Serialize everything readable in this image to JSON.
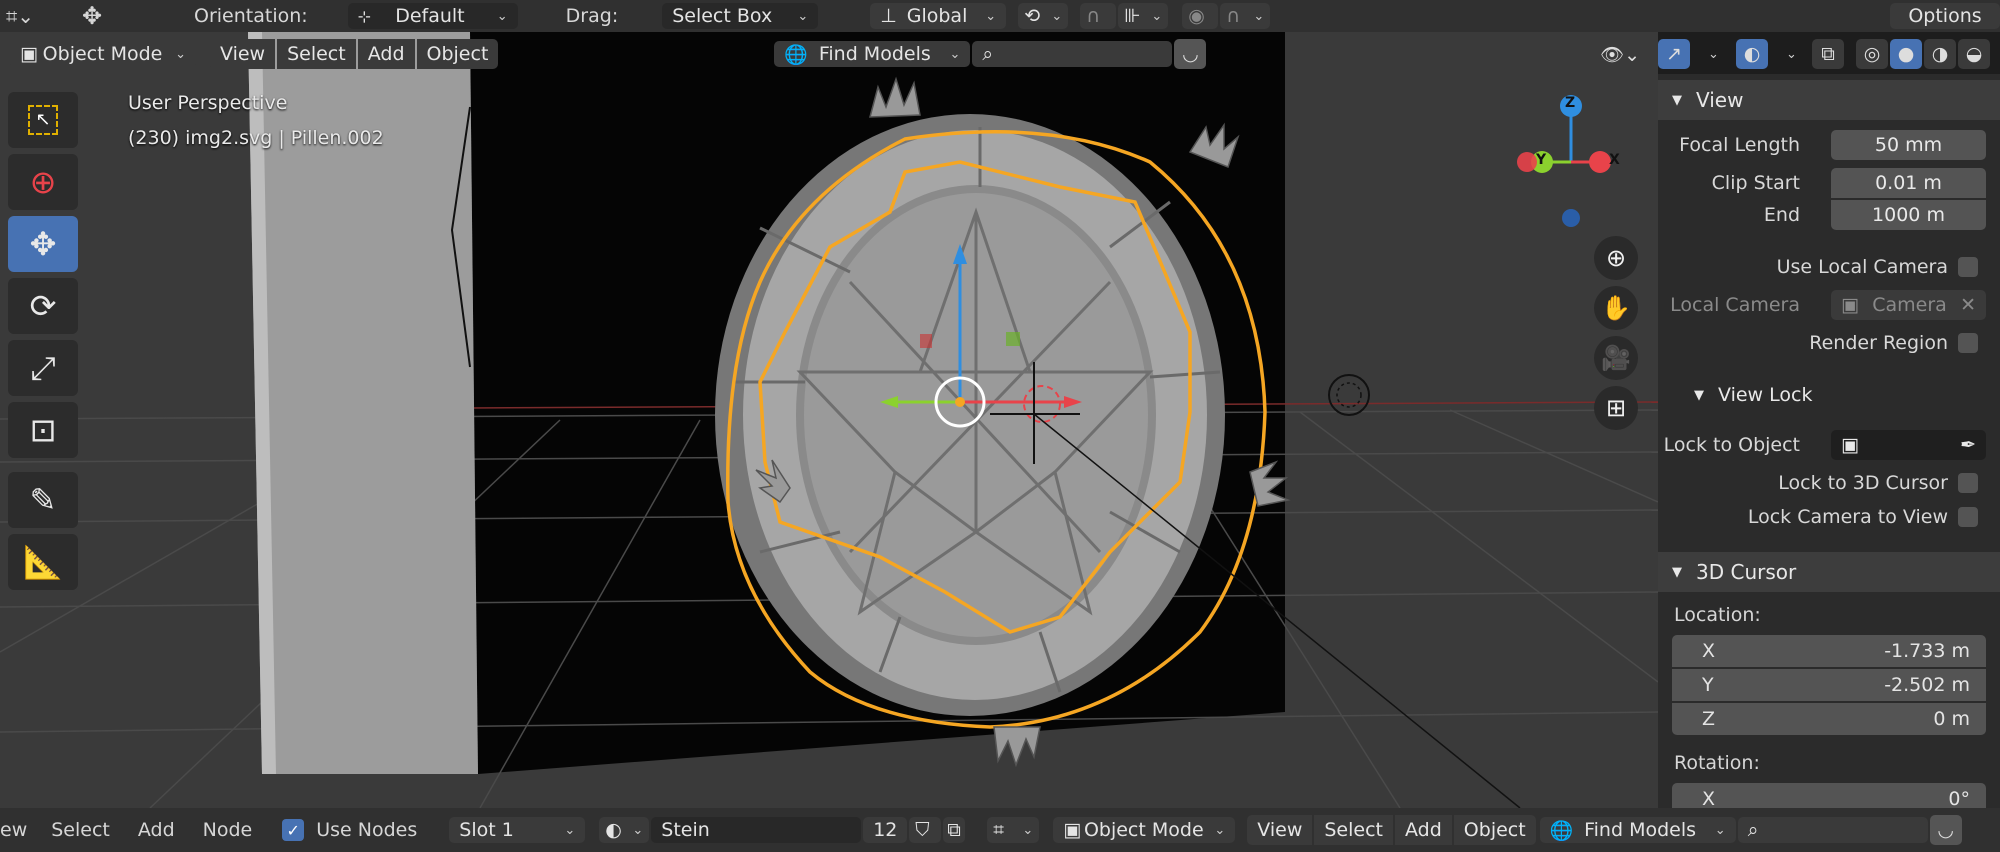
{
  "topbar": {
    "orientation_label": "Orientation:",
    "orientation_value": "Default",
    "drag_label": "Drag:",
    "drag_value": "Select Box",
    "transform_orientation": "Global",
    "options_label": "Options"
  },
  "header": {
    "mode": "Object Mode",
    "menu": [
      "View",
      "Select",
      "Add",
      "Object"
    ],
    "asset_search": "Find Models"
  },
  "viewport": {
    "perspective": "User Perspective",
    "object_info": "(230) img2.svg | Pillen.002",
    "gizmo_axes": {
      "z": "Z",
      "y": "Y",
      "x": "X"
    }
  },
  "tools": [
    "select-box",
    "cursor",
    "move",
    "rotate",
    "scale",
    "transform",
    "annotate",
    "measure"
  ],
  "active_tool": "move",
  "panel": {
    "view_title": "View",
    "focal_length_label": "Focal Length",
    "focal_length_value": "50 mm",
    "clip_start_label": "Clip Start",
    "clip_start_value": "0.01 m",
    "end_label": "End",
    "end_value": "1000 m",
    "use_local_camera": "Use Local Camera",
    "local_camera_label": "Local Camera",
    "local_camera_value": "Camera",
    "render_region": "Render Region",
    "view_lock_title": "View Lock",
    "lock_to_object": "Lock to Object",
    "lock_to_cursor": "Lock to 3D Cursor",
    "lock_camera": "Lock Camera to View",
    "cursor_title": "3D Cursor",
    "location_label": "Location:",
    "loc_x_label": "X",
    "loc_x_value": "-1.733 m",
    "loc_y_label": "Y",
    "loc_y_value": "-2.502 m",
    "loc_z_label": "Z",
    "loc_z_value": "0 m",
    "rotation_label": "Rotation:",
    "rot_x_label": "X",
    "rot_x_value": "0°"
  },
  "bottombar": {
    "left_menu": [
      "ew",
      "Select",
      "Add",
      "Node"
    ],
    "use_nodes": "Use Nodes",
    "slot": "Slot 1",
    "material": "Stein",
    "users": "12",
    "mode": "Object Mode",
    "menu": [
      "View",
      "Select",
      "Add",
      "Object"
    ],
    "asset_search": "Find Models"
  },
  "colors": {
    "accent": "#4772b3",
    "selection_outline": "#f5a623",
    "axis_x": "#e8434a",
    "axis_y": "#8bd12e",
    "axis_z": "#2f8ee0"
  }
}
